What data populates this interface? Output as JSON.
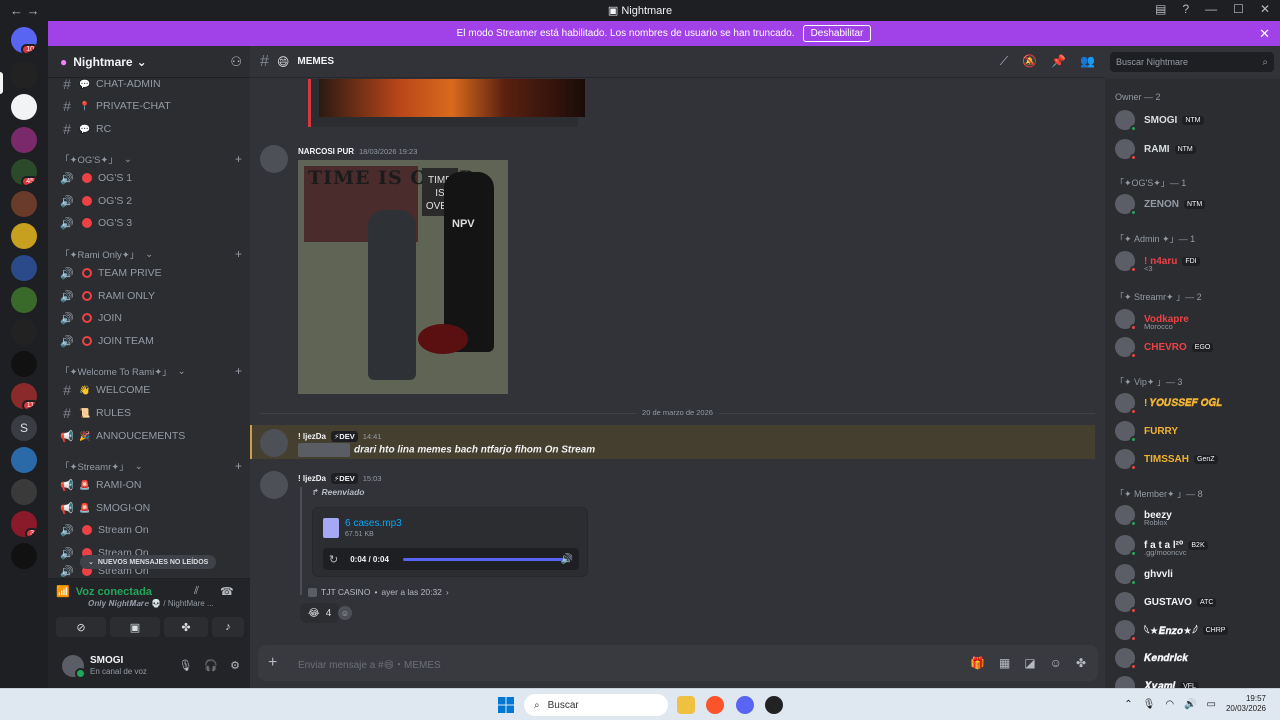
{
  "window": {
    "title": "Nightmare",
    "back": "←",
    "forward": "→"
  },
  "banner": {
    "text": "El modo Streamer está habilitado. Los nombres de usuario se han truncado.",
    "button": "Deshabilitar"
  },
  "guilds": {
    "badges": [
      "10",
      "45",
      "11",
      "3"
    ],
    "letter_server": "S"
  },
  "server": {
    "name": "Nightmare"
  },
  "sidebar": {
    "channels": [
      {
        "label": "CHAT-ADMIN"
      },
      {
        "label": "PRIVATE-CHAT"
      },
      {
        "label": "RC"
      }
    ],
    "categories": [
      "「✦OG'S✦」",
      "「✦Rami Only✦」",
      "「✦Welcome To Rami✦」",
      "「✦Streamr✦」"
    ],
    "og_voice": [
      "OG'S 1",
      "OG'S 2",
      "OG'S 3"
    ],
    "rami_voice": [
      "TEAM PRIVE",
      "RAMI ONLY",
      "JOIN",
      "JOIN TEAM"
    ],
    "welcome": [
      "WELCOME",
      "RULES",
      "ANNOUCEMENTS"
    ],
    "streamr": [
      "RAMI-ON",
      "SMOGI-ON",
      "Stream On",
      "Stream On",
      "Stream On"
    ],
    "unread_pill": "NUEVOS MENSAJES NO LEÍDOS"
  },
  "voice": {
    "status": "Voz conectada",
    "sub": "𝑶𝒏𝒍𝒚 𝑵𝒊𝒈𝒉𝒕𝑴𝒂𝒓𝒆 💀 / NightMare ..."
  },
  "user": {
    "name": "SMOGI",
    "status": "En canal de voz"
  },
  "channel": {
    "name": "MEMES",
    "search_placeholder": "Buscar Nightmare"
  },
  "messages": {
    "m1": {
      "author": "NARCOSI PUR",
      "time": "18/03/2026 19:23",
      "image_text_left": "TIME IS OVER",
      "image_text_right": "TIME IS OVER",
      "image_shirt": "NPV"
    },
    "date_divider": "20 de marzo de 2026",
    "m2": {
      "author": "! ljezDa",
      "tag": "DEV",
      "time": "14:41",
      "text": "drari hto lina memes bach ntfarjo fihom On Stream"
    },
    "m3": {
      "author": "! ljezDa",
      "tag": "DEV",
      "time": "15:03",
      "forwarded": "Reenviado",
      "file_name": "6 cases.mp3",
      "file_size": "67.51 KB",
      "audio_time": "0:04 / 0:04",
      "source": "TJT CASINO",
      "source_time": "ayer a las 20:32",
      "reaction_count": "4"
    }
  },
  "composer": {
    "placeholder": "Enviar mensaje a #😄・MEMES"
  },
  "members": {
    "groups": [
      "Owner — 2",
      "「✦OG'S✦」— 1",
      "「✦ Admin ✦」— 1",
      "「✦ Streamr✦ 」— 2",
      "「✦ Vip✦ 」— 3",
      "「✦ Member✦ 」— 8"
    ],
    "list": [
      {
        "name": "SMOGI",
        "tag": "NTM",
        "color": "#dbdee1",
        "status": "#23a55a"
      },
      {
        "name": "RAMI",
        "tag": "NTM",
        "color": "#dbdee1",
        "status": "#ed4245"
      },
      {
        "name": "ZENON",
        "tag": "NTM",
        "color": "#949ba4",
        "status": "#23a55a"
      },
      {
        "name": "! n4aru",
        "tag": "FDI",
        "color": "#ed4245",
        "status": "#ed4245",
        "sub": "<3"
      },
      {
        "name": "Vodkapre",
        "tag": "",
        "color": "#ed4245",
        "status": "#ed4245",
        "sub": "Morocco"
      },
      {
        "name": "CHEVRO",
        "tag": "EGO",
        "color": "#ed4245",
        "status": "#ed4245"
      },
      {
        "name": "! 𝒀𝑶𝑼𝑺𝑺𝑬𝑭 𝑶𝑮𝑳",
        "tag": "",
        "color": "#f0b232",
        "status": "#ed4245"
      },
      {
        "name": "FURRY",
        "tag": "",
        "color": "#f0b232",
        "status": "#23a55a"
      },
      {
        "name": "TIMSSAH",
        "tag": "GenZ",
        "color": "#f0b232",
        "status": "#ed4245"
      },
      {
        "name": "beezy",
        "tag": "",
        "color": "#f2f3f5",
        "status": "#23a55a",
        "sub": "Roblox"
      },
      {
        "name": "f a t a l²⁰",
        "tag": "B2K",
        "color": "#f2f3f5",
        "status": "#23a55a",
        "sub": ".gg/mooncvc"
      },
      {
        "name": "ghvvli",
        "tag": "",
        "color": "#f2f3f5",
        "status": "#23a55a"
      },
      {
        "name": "GUSTAVO",
        "tag": "ATC",
        "color": "#f2f3f5",
        "status": "#ed4245"
      },
      {
        "name": "𓆩★𝑬𝒏𝒛𝒐★𓆪",
        "tag": "CHRP",
        "color": "#f2f3f5",
        "status": "#ed4245"
      },
      {
        "name": "𝑲𝒆𝒏𝒅𝒓𝒊𝒄𝒌",
        "tag": "",
        "color": "#f2f3f5",
        "status": "#ed4245"
      },
      {
        "name": "𝑿𝒚𝒂𝒎𝒊",
        "tag": "VFL",
        "color": "#f2f3f5",
        "status": "#ed4245"
      }
    ]
  },
  "taskbar": {
    "search": "Buscar",
    "time": "19:57",
    "date": "20/03/2026"
  }
}
